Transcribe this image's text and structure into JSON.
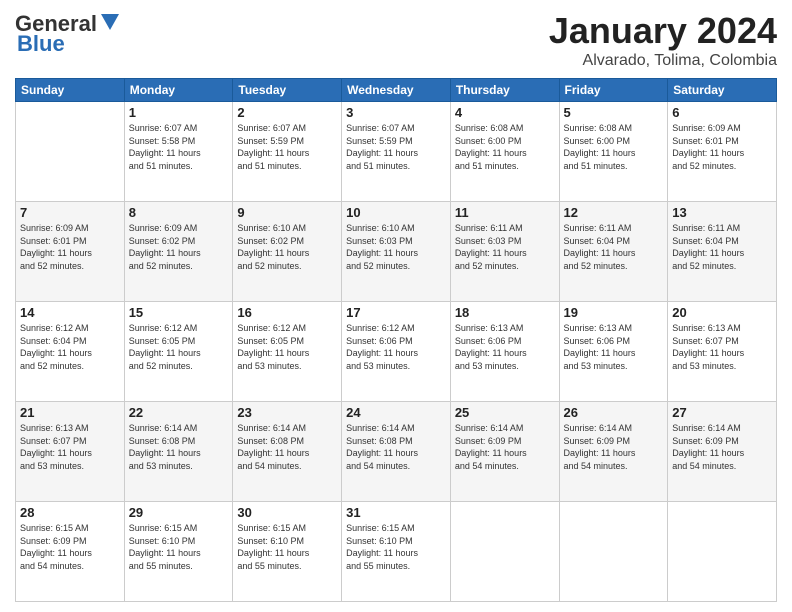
{
  "header": {
    "logo_line1": "General",
    "logo_line2": "Blue",
    "month": "January 2024",
    "location": "Alvarado, Tolima, Colombia"
  },
  "days_of_week": [
    "Sunday",
    "Monday",
    "Tuesday",
    "Wednesday",
    "Thursday",
    "Friday",
    "Saturday"
  ],
  "weeks": [
    [
      {
        "day": "",
        "info": ""
      },
      {
        "day": "1",
        "info": "Sunrise: 6:07 AM\nSunset: 5:58 PM\nDaylight: 11 hours\nand 51 minutes."
      },
      {
        "day": "2",
        "info": "Sunrise: 6:07 AM\nSunset: 5:59 PM\nDaylight: 11 hours\nand 51 minutes."
      },
      {
        "day": "3",
        "info": "Sunrise: 6:07 AM\nSunset: 5:59 PM\nDaylight: 11 hours\nand 51 minutes."
      },
      {
        "day": "4",
        "info": "Sunrise: 6:08 AM\nSunset: 6:00 PM\nDaylight: 11 hours\nand 51 minutes."
      },
      {
        "day": "5",
        "info": "Sunrise: 6:08 AM\nSunset: 6:00 PM\nDaylight: 11 hours\nand 51 minutes."
      },
      {
        "day": "6",
        "info": "Sunrise: 6:09 AM\nSunset: 6:01 PM\nDaylight: 11 hours\nand 52 minutes."
      }
    ],
    [
      {
        "day": "7",
        "info": "Sunrise: 6:09 AM\nSunset: 6:01 PM\nDaylight: 11 hours\nand 52 minutes."
      },
      {
        "day": "8",
        "info": "Sunrise: 6:09 AM\nSunset: 6:02 PM\nDaylight: 11 hours\nand 52 minutes."
      },
      {
        "day": "9",
        "info": "Sunrise: 6:10 AM\nSunset: 6:02 PM\nDaylight: 11 hours\nand 52 minutes."
      },
      {
        "day": "10",
        "info": "Sunrise: 6:10 AM\nSunset: 6:03 PM\nDaylight: 11 hours\nand 52 minutes."
      },
      {
        "day": "11",
        "info": "Sunrise: 6:11 AM\nSunset: 6:03 PM\nDaylight: 11 hours\nand 52 minutes."
      },
      {
        "day": "12",
        "info": "Sunrise: 6:11 AM\nSunset: 6:04 PM\nDaylight: 11 hours\nand 52 minutes."
      },
      {
        "day": "13",
        "info": "Sunrise: 6:11 AM\nSunset: 6:04 PM\nDaylight: 11 hours\nand 52 minutes."
      }
    ],
    [
      {
        "day": "14",
        "info": "Sunrise: 6:12 AM\nSunset: 6:04 PM\nDaylight: 11 hours\nand 52 minutes."
      },
      {
        "day": "15",
        "info": "Sunrise: 6:12 AM\nSunset: 6:05 PM\nDaylight: 11 hours\nand 52 minutes."
      },
      {
        "day": "16",
        "info": "Sunrise: 6:12 AM\nSunset: 6:05 PM\nDaylight: 11 hours\nand 53 minutes."
      },
      {
        "day": "17",
        "info": "Sunrise: 6:12 AM\nSunset: 6:06 PM\nDaylight: 11 hours\nand 53 minutes."
      },
      {
        "day": "18",
        "info": "Sunrise: 6:13 AM\nSunset: 6:06 PM\nDaylight: 11 hours\nand 53 minutes."
      },
      {
        "day": "19",
        "info": "Sunrise: 6:13 AM\nSunset: 6:06 PM\nDaylight: 11 hours\nand 53 minutes."
      },
      {
        "day": "20",
        "info": "Sunrise: 6:13 AM\nSunset: 6:07 PM\nDaylight: 11 hours\nand 53 minutes."
      }
    ],
    [
      {
        "day": "21",
        "info": "Sunrise: 6:13 AM\nSunset: 6:07 PM\nDaylight: 11 hours\nand 53 minutes."
      },
      {
        "day": "22",
        "info": "Sunrise: 6:14 AM\nSunset: 6:08 PM\nDaylight: 11 hours\nand 53 minutes."
      },
      {
        "day": "23",
        "info": "Sunrise: 6:14 AM\nSunset: 6:08 PM\nDaylight: 11 hours\nand 54 minutes."
      },
      {
        "day": "24",
        "info": "Sunrise: 6:14 AM\nSunset: 6:08 PM\nDaylight: 11 hours\nand 54 minutes."
      },
      {
        "day": "25",
        "info": "Sunrise: 6:14 AM\nSunset: 6:09 PM\nDaylight: 11 hours\nand 54 minutes."
      },
      {
        "day": "26",
        "info": "Sunrise: 6:14 AM\nSunset: 6:09 PM\nDaylight: 11 hours\nand 54 minutes."
      },
      {
        "day": "27",
        "info": "Sunrise: 6:14 AM\nSunset: 6:09 PM\nDaylight: 11 hours\nand 54 minutes."
      }
    ],
    [
      {
        "day": "28",
        "info": "Sunrise: 6:15 AM\nSunset: 6:09 PM\nDaylight: 11 hours\nand 54 minutes."
      },
      {
        "day": "29",
        "info": "Sunrise: 6:15 AM\nSunset: 6:10 PM\nDaylight: 11 hours\nand 55 minutes."
      },
      {
        "day": "30",
        "info": "Sunrise: 6:15 AM\nSunset: 6:10 PM\nDaylight: 11 hours\nand 55 minutes."
      },
      {
        "day": "31",
        "info": "Sunrise: 6:15 AM\nSunset: 6:10 PM\nDaylight: 11 hours\nand 55 minutes."
      },
      {
        "day": "",
        "info": ""
      },
      {
        "day": "",
        "info": ""
      },
      {
        "day": "",
        "info": ""
      }
    ]
  ]
}
